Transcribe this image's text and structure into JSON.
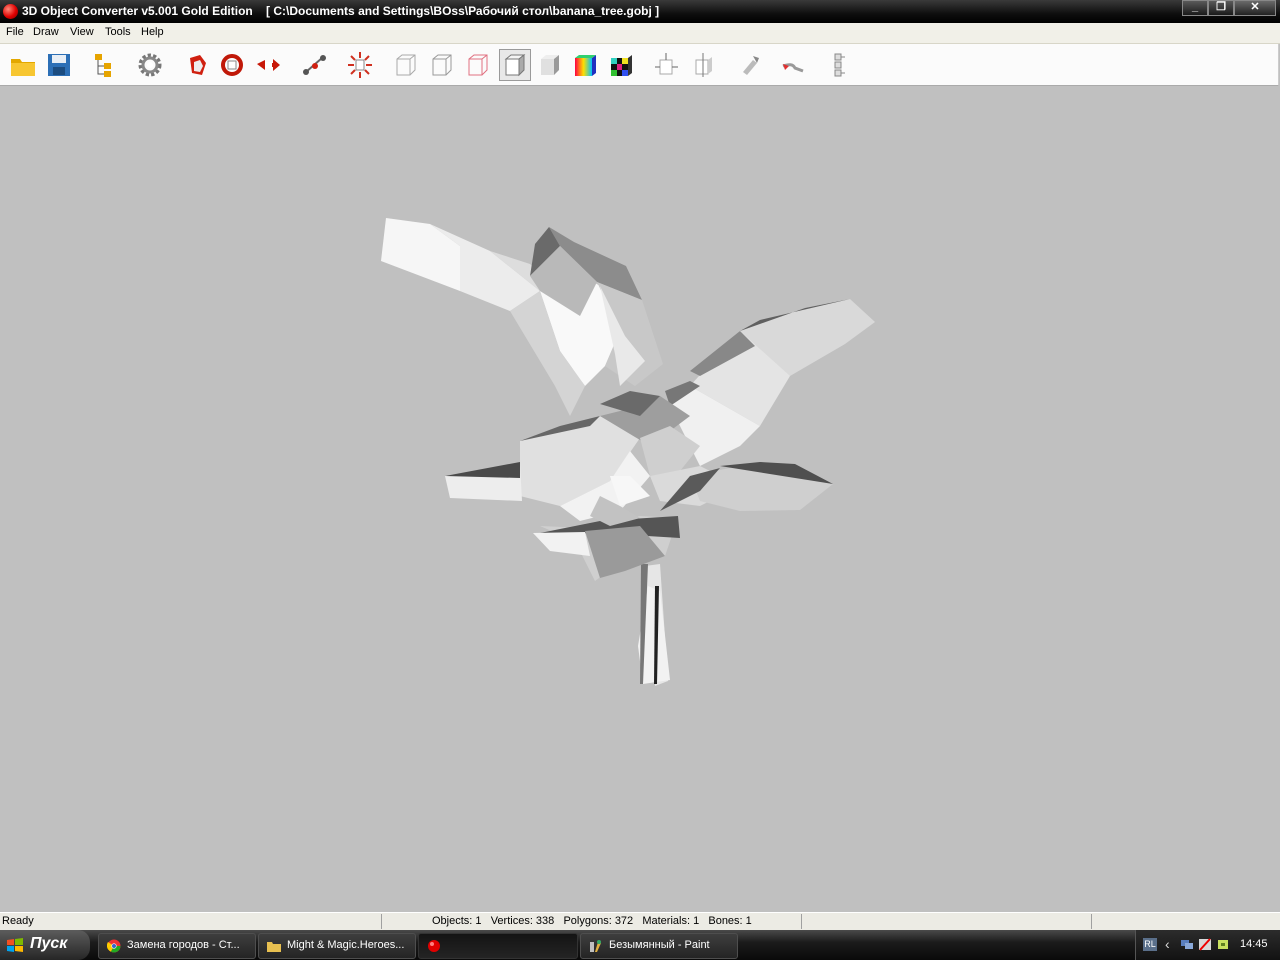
{
  "window": {
    "title": "3D Object Converter v5.001 Gold Edition    [ C:\\Documents and Settings\\BOss\\Рабочий стол\\banana_tree.gobj ]",
    "controls": {
      "minimize": "_",
      "maximize": "❐",
      "close": "✕"
    }
  },
  "menu": {
    "file": "File",
    "draw": "Draw",
    "view": "View",
    "tools": "Tools",
    "help": "Help"
  },
  "toolbar": {
    "icons": [
      "open-folder-icon",
      "save-disk-icon",
      "hierarchy-icon",
      "settings-gear-icon",
      "rotate-icon",
      "orbit-icon",
      "move-icon",
      "bone-icon",
      "explode-icon",
      "wireframe-box-icon",
      "wireframe-box-icon",
      "wireframe-red-box-icon",
      "flat-shaded-box-icon",
      "smooth-shaded-box-icon",
      "color-cube-icon",
      "texture-cube-icon",
      "normals-box-icon",
      "cut-box-icon",
      "pick-icon",
      "brush-icon",
      "bone-chain-icon"
    ],
    "pressed": "flat-shaded-box-icon"
  },
  "status": {
    "ready": "Ready",
    "stats": "Objects: 1   Vertices: 338   Polygons: 372   Materials: 1   Bones: 1"
  },
  "taskbar": {
    "start": "Пуск",
    "tasks": [
      {
        "label": "Замена городов - Ст...",
        "icon": "chrome-icon"
      },
      {
        "label": "Might & Magic.Heroes...",
        "icon": "folder-icon"
      },
      {
        "label": "",
        "icon": "converter-app-icon"
      },
      {
        "label": "Безымянный - Paint",
        "icon": "paint-icon"
      }
    ],
    "tray": {
      "lang": "RL",
      "clock": "14:45"
    }
  },
  "colors": {
    "viewport_bg": "#c0c0c0",
    "titlebar": "#000000",
    "accent_red": "#e00000"
  }
}
